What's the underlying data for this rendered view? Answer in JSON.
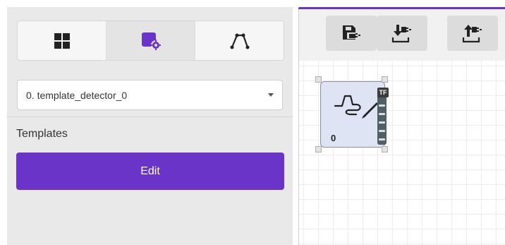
{
  "sidebar": {
    "tabs": [
      {
        "icon": "grid-icon"
      },
      {
        "icon": "node-settings-icon"
      },
      {
        "icon": "graph-icon"
      }
    ],
    "active_tab": 1,
    "selector": {
      "value": "0. template_detector_0"
    },
    "section_label": "Templates",
    "edit_label": "Edit"
  },
  "toolbar": {
    "buttons": [
      {
        "icon": "save-icon"
      },
      {
        "icon": "download-icon"
      },
      {
        "icon": "upload-icon"
      }
    ]
  },
  "canvas": {
    "node": {
      "badge": "TF",
      "index": "0",
      "icon": "template-draw-icon"
    }
  },
  "colors": {
    "accent": "#6b34c9",
    "panel_bg": "#e9e9e9",
    "node_bg": "#dfe4f4",
    "port_strip": "#4f6164"
  }
}
